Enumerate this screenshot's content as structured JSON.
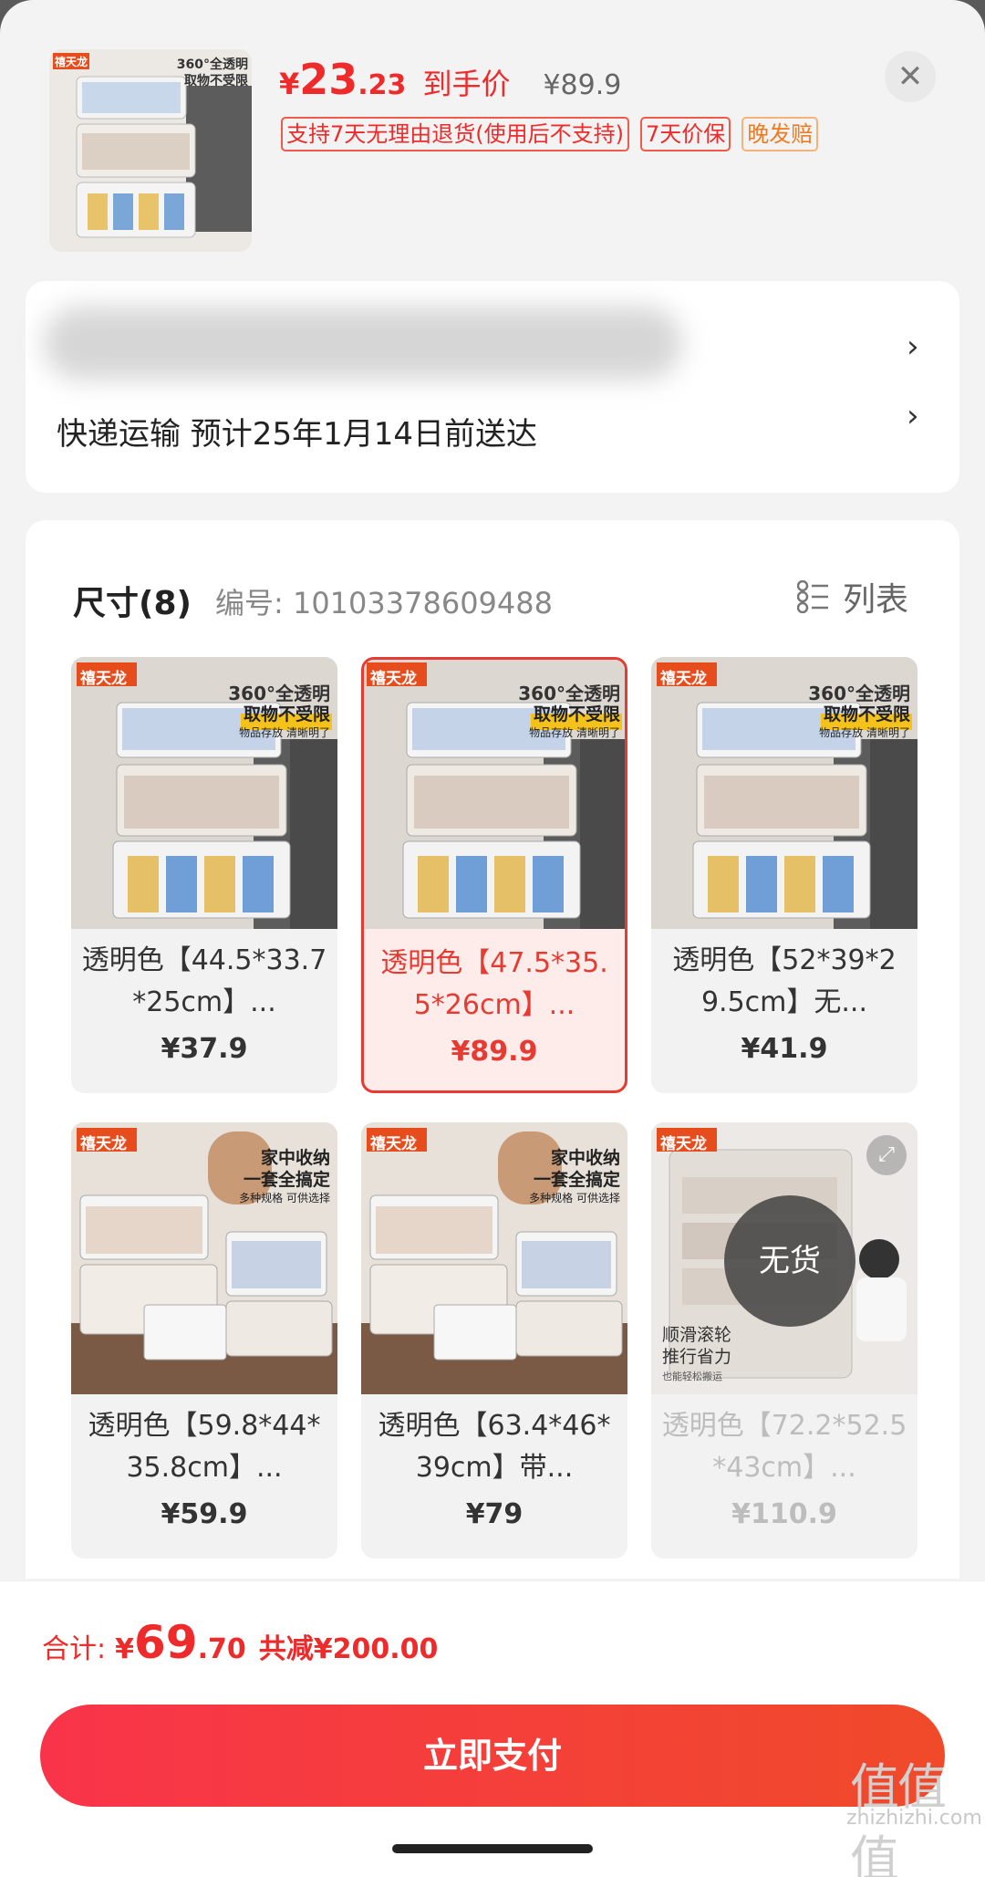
{
  "header": {
    "price_currency": "¥",
    "price_int": "23",
    "price_dec": ".23",
    "price_tag": "到手价",
    "original_price": "¥89.9",
    "badges": [
      "支持7天无理由退货(使用后不支持)",
      "7天价保",
      "晚发赔"
    ],
    "thumb_brand": "禧天龙",
    "thumb_slogan_1": "360°全透明",
    "thumb_slogan_2": "取物不受限"
  },
  "delivery": {
    "text": "快递运输 预计25年1月14日前送达"
  },
  "size_section": {
    "title": "尺寸(8)",
    "code": "编号: 10103378609488",
    "list_label": "列表",
    "items": [
      {
        "name": "透明色【44.5*33.7*25cm】...",
        "price": "¥37.9",
        "brand": "禧天龙",
        "slogan_1": "360°全透明",
        "slogan_2": "取物不受限",
        "slogan_3": "物品存放 清晰明了"
      },
      {
        "name": "透明色【47.5*35.5*26cm】...",
        "price": "¥89.9",
        "brand": "禧天龙",
        "slogan_1": "360°全透明",
        "slogan_2": "取物不受限",
        "slogan_3": "物品存放 清晰明了"
      },
      {
        "name": "透明色【52*39*29.5cm】无...",
        "price": "¥41.9",
        "brand": "禧天龙",
        "slogan_1": "360°全透明",
        "slogan_2": "取物不受限",
        "slogan_3": "物品存放 清晰明了"
      },
      {
        "name": "透明色【59.8*44*35.8cm】...",
        "price": "¥59.9",
        "brand": "禧天龙",
        "slogan_1": "家中收纳",
        "slogan_2": "一套全搞定",
        "slogan_3": "多种规格 可供选择"
      },
      {
        "name": "透明色【63.4*46*39cm】带...",
        "price": "¥79",
        "brand": "禧天龙",
        "slogan_1": "家中收纳",
        "slogan_2": "一套全搞定",
        "slogan_3": "多种规格 可供选择"
      },
      {
        "name": "透明色【72.2*52.5*43cm】...",
        "price": "¥110.9",
        "brand": "禧天龙",
        "slogan_1": "顺滑滚轮",
        "slogan_2": "推行省力",
        "slogan_3": "也能轻松搬运",
        "soldout": "无货"
      }
    ]
  },
  "footer": {
    "total_label": "合计:",
    "total_currency": "¥",
    "total_int": "69",
    "total_dec": ".70",
    "discount": "共减¥200.00",
    "pay_label": "立即支付",
    "watermark": "zhizhizhi.com",
    "watermark_glyphs": "值值值"
  },
  "colors": {
    "accent": "#ee2a2a",
    "pay_gradient_start": "#f9344a",
    "pay_gradient_end": "#f04a2a",
    "badge_orange": "#f07a20"
  }
}
